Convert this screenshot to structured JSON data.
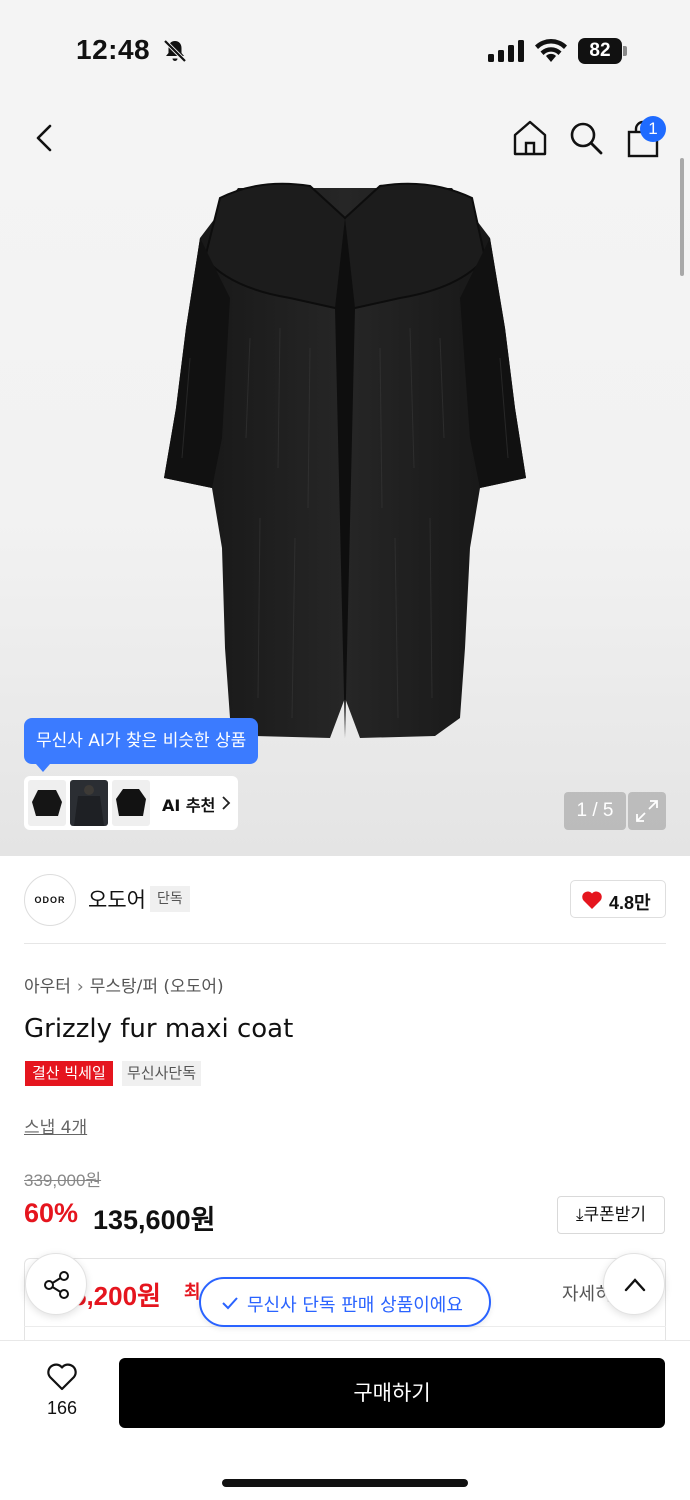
{
  "status_bar": {
    "time": "12:48",
    "battery": "82",
    "icons": [
      "bell-muted-icon",
      "signal-icon",
      "wifi-icon",
      "battery-icon"
    ]
  },
  "nav": {
    "icons": [
      "back-icon",
      "home-icon",
      "search-icon",
      "shopping-bag-icon"
    ],
    "cart_badge": "1"
  },
  "gallery": {
    "ai_tooltip": "무신사 AI가 찾은 비슷한 상품",
    "ai_recommend_label": "AI 추천",
    "counter": "1 / 5",
    "expand_icon": "expand-icon"
  },
  "brand": {
    "logo_text": "ODOR",
    "name": "오도어",
    "tag": "단독",
    "likes": "4.8만",
    "like_icon": "heart-filled-icon",
    "like_color": "#e5151e"
  },
  "product": {
    "breadcrumb": [
      "아우터",
      "무스탕/퍼 (오도어)"
    ],
    "title": "Grizzly fur maxi coat",
    "badges": [
      "결산 빅세일",
      "무신사단독"
    ],
    "snap_link": "스냅 4개",
    "original_price": "339,000원",
    "discount": "60%",
    "sale_price": "135,600원",
    "coupon_label": "쿠폰받기",
    "benefit_price": "5,200원",
    "benefit_note": "최",
    "benefit_detail": "자세히"
  },
  "floating": {
    "exclusive_notice": "무신사 단독 판매 상품이에요",
    "share_icon": "share-icon",
    "top_icon": "chevron-up-icon"
  },
  "bottom_bar": {
    "wish_count": "166",
    "buy_label": "구매하기"
  },
  "colors": {
    "accent_blue": "#2a63ff",
    "sale_red": "#e5151e",
    "primary_black": "#000000"
  }
}
